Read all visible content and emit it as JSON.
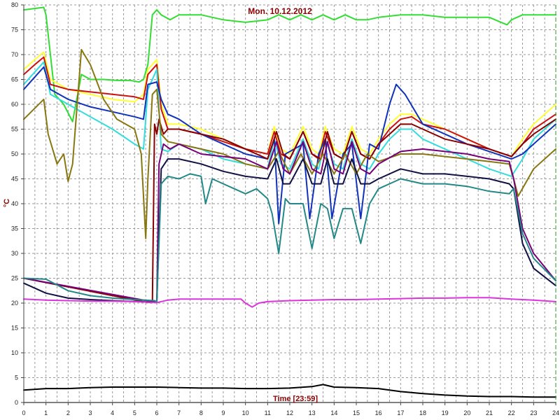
{
  "chart_data": {
    "type": "line",
    "title": "Mon. 10.12.2012",
    "xlabel": "Time [23:59]",
    "ylabel": "°C",
    "xlim": [
      0,
      24
    ],
    "ylim": [
      0,
      80
    ],
    "xticks": [
      "0",
      "1",
      "2",
      "3",
      "4",
      "5",
      "6",
      "7",
      "8",
      "9",
      "10",
      "11",
      "12",
      "13",
      "14",
      "15",
      "16",
      "17",
      "18",
      "19",
      "20",
      "21",
      "22",
      "23",
      "24"
    ],
    "yticks": [
      "0",
      "5",
      "10",
      "15",
      "20",
      "25",
      "30",
      "35",
      "40",
      "45",
      "50",
      "55",
      "60",
      "65",
      "70",
      "75",
      "80"
    ],
    "grid": true,
    "series": [
      {
        "color": "#33dd33",
        "x": [
          0,
          0.9,
          1,
          1.4,
          1.8,
          2.2,
          2.6,
          3,
          3.6,
          4.2,
          4.8,
          5.2,
          5.4,
          5.6,
          5.8,
          6,
          6.2,
          6.6,
          7,
          8,
          9,
          10,
          11,
          11.5,
          12,
          12.5,
          13,
          13.5,
          14,
          14.5,
          15,
          15.5,
          16,
          17,
          18,
          19,
          20,
          21,
          21.8,
          22,
          22.5,
          23,
          24
        ],
        "y": [
          79,
          79.5,
          78,
          62,
          60,
          56.5,
          66,
          65,
          65,
          64.8,
          64.8,
          64.5,
          65,
          68,
          78,
          79,
          78,
          77,
          78,
          78,
          77,
          76.5,
          77,
          78,
          77,
          78,
          77,
          78,
          77,
          78,
          77,
          77,
          77.5,
          78,
          78,
          77.5,
          77.5,
          77.5,
          76,
          77,
          78,
          78,
          78
        ]
      },
      {
        "color": "#ffff33",
        "x": [
          0,
          0.5,
          0.9,
          1.2,
          2,
          3,
          4,
          5,
          5.4,
          5.6,
          6,
          6.2,
          6.5,
          7,
          8,
          9,
          10,
          11,
          11.3,
          11.6,
          12,
          12.6,
          13,
          13.3,
          13.6,
          14,
          14.4,
          14.8,
          15.2,
          15.6,
          16,
          16.5,
          17,
          17.5,
          18,
          19,
          20,
          21,
          22,
          22.5,
          23,
          24
        ],
        "y": [
          67,
          69,
          70.5,
          65,
          63,
          62,
          61,
          60.5,
          62,
          67,
          69,
          60,
          56,
          56,
          55,
          53,
          51,
          50,
          55.5,
          51,
          50,
          55.5,
          51,
          50,
          55.5,
          51,
          50,
          55.5,
          51,
          50,
          53,
          56,
          58,
          58,
          57,
          55,
          53,
          51,
          49.5,
          53,
          56,
          60
        ]
      },
      {
        "color": "#cc1111",
        "x": [
          0,
          0.5,
          0.9,
          1.2,
          2,
          3,
          4,
          5,
          5.4,
          5.6,
          6,
          6.2,
          6.5,
          7,
          8,
          9,
          10,
          11,
          11.3,
          11.6,
          12,
          12.6,
          13,
          13.3,
          13.6,
          14,
          14.4,
          14.8,
          15.2,
          15.6,
          16,
          16.5,
          17,
          17.5,
          18,
          19,
          20,
          21,
          22,
          22.5,
          23,
          24
        ],
        "y": [
          66,
          68,
          69.5,
          64,
          63,
          62.5,
          62,
          61.5,
          61,
          66,
          68,
          59,
          55,
          55,
          54,
          52.5,
          51,
          50,
          54.5,
          50,
          49,
          54.5,
          50,
          49,
          54.5,
          50,
          49,
          54.5,
          50,
          49,
          52,
          55,
          57,
          57.5,
          56,
          55,
          53,
          51,
          49.5,
          52,
          55,
          58
        ]
      },
      {
        "color": "#33dddd",
        "x": [
          0,
          0.5,
          0.9,
          1.2,
          2,
          3,
          4,
          5,
          5.4,
          5.6,
          6,
          6.2,
          6.5,
          7,
          8,
          9,
          10,
          11,
          11.3,
          11.6,
          12,
          12.6,
          13,
          13.3,
          13.6,
          14,
          14.4,
          14.8,
          15.2,
          15.6,
          16,
          16.5,
          17,
          17.5,
          18,
          19,
          20,
          21,
          22,
          22.5,
          23,
          24
        ],
        "y": [
          64,
          66.5,
          68.5,
          62,
          60,
          57.5,
          55,
          52,
          51,
          63,
          67,
          51,
          50.5,
          52,
          51,
          49,
          48,
          47,
          53,
          48,
          47,
          53,
          48,
          47,
          53,
          48,
          47,
          53,
          48,
          47,
          50,
          53,
          55,
          55,
          53,
          51,
          49,
          47,
          45.5,
          49,
          53,
          57
        ]
      },
      {
        "color": "#1133bb",
        "x": [
          0,
          0.5,
          0.9,
          1.2,
          2,
          3,
          4,
          5,
          5.4,
          5.6,
          6,
          6.2,
          6.5,
          7,
          8,
          9,
          10,
          11,
          11.3,
          11.5,
          11.8,
          12.6,
          12.9,
          13.3,
          13.6,
          13.9,
          14.4,
          14.8,
          15.2,
          15.6,
          16,
          16.5,
          16.8,
          17.2,
          18,
          19,
          20,
          21,
          22,
          22.5,
          23,
          24
        ],
        "y": [
          63,
          65.5,
          67.5,
          63,
          61,
          59.5,
          58.5,
          57.5,
          57,
          64,
          64.5,
          61,
          58,
          57,
          54,
          52,
          50,
          49,
          53,
          36,
          50,
          52,
          37,
          50,
          53,
          37,
          50,
          52,
          37,
          52,
          51,
          60,
          64,
          62,
          56,
          54,
          52,
          50.5,
          49,
          50,
          52,
          56
        ]
      },
      {
        "color": "#880000",
        "x": [
          0,
          5.5,
          5.8,
          5.9,
          6,
          6.1,
          6.3,
          6.5,
          7,
          8,
          9,
          10,
          11,
          11.4,
          11.7,
          12,
          12.6,
          13,
          13.4,
          13.7,
          14,
          14.4,
          14.8,
          15.2,
          15.6,
          16,
          16.5,
          17,
          17.5,
          18,
          19,
          20,
          21,
          22,
          22.5,
          23,
          24
        ],
        "y": [
          25,
          20.2,
          20.1,
          56,
          54,
          57,
          54,
          55,
          55,
          54,
          53,
          51,
          49,
          54.5,
          50,
          49,
          54.5,
          50,
          49,
          54.5,
          50,
          49,
          54.5,
          50,
          49,
          52,
          54,
          56,
          56,
          55,
          53,
          52,
          51,
          49.5,
          52,
          54,
          57
        ]
      },
      {
        "color": "#887711",
        "x": [
          0,
          0.9,
          1.1,
          1.5,
          1.8,
          2,
          2.2,
          2.6,
          3,
          3.6,
          4.2,
          5,
          5.3,
          5.5,
          5.6,
          5.8,
          6,
          6.2,
          6.5,
          7,
          8,
          9,
          10,
          11,
          11.5,
          12,
          12.5,
          13,
          13.5,
          14,
          14.5,
          15,
          15.5,
          16,
          17,
          18,
          19,
          20,
          21,
          21.9,
          22.1,
          22.3,
          23,
          24
        ],
        "y": [
          57,
          61,
          54,
          48,
          50,
          44.5,
          48,
          71,
          68,
          61,
          57,
          55,
          50,
          33,
          45,
          62,
          63,
          54,
          52.5,
          52,
          51,
          50,
          48,
          47,
          50.5,
          46,
          50,
          46,
          50,
          46,
          50,
          46,
          50,
          48.5,
          50,
          50,
          49.5,
          49,
          48.5,
          48,
          45,
          41.5,
          47,
          51
        ]
      },
      {
        "color": "#bbbbbb",
        "x": [
          0,
          24
        ],
        "y": [
          0,
          0
        ]
      },
      {
        "color": "#770077",
        "x": [
          0,
          5.9,
          6,
          6.1,
          6.3,
          6.6,
          7,
          8,
          9,
          10,
          11,
          11.4,
          11.7,
          12,
          12.6,
          13,
          13.4,
          13.7,
          14,
          14.4,
          14.8,
          15.2,
          15.6,
          16,
          17,
          18,
          19,
          20,
          21,
          21.9,
          22.1,
          22.5,
          23,
          24
        ],
        "y": [
          25,
          20.2,
          20.1,
          48,
          52,
          51,
          52,
          50,
          49.5,
          49,
          47,
          52.5,
          47,
          46,
          52.5,
          47,
          46,
          52.5,
          47,
          46,
          52.5,
          47,
          46,
          48,
          50.5,
          51,
          50.5,
          50,
          49,
          48.5,
          45,
          35,
          30,
          24.5
        ]
      },
      {
        "color": "#111144",
        "x": [
          0,
          1,
          2,
          3,
          4,
          5,
          5.9,
          6,
          6.2,
          6.5,
          7,
          8,
          9,
          10,
          11,
          11.4,
          11.7,
          12,
          12.6,
          13,
          13.4,
          13.7,
          14,
          14.4,
          14.8,
          15.2,
          15.6,
          16,
          17,
          18,
          19,
          20,
          21,
          21.9,
          22.1,
          22.5,
          23,
          24
        ],
        "y": [
          24,
          22,
          21,
          20.7,
          20.5,
          20.3,
          20.2,
          20.1,
          47,
          49,
          49,
          48,
          46.5,
          45.5,
          45,
          49,
          44,
          44,
          49,
          44,
          44,
          49,
          44,
          44,
          49,
          44,
          44,
          45,
          47,
          46,
          46,
          45.5,
          45,
          44,
          43,
          32,
          27,
          23.5
        ]
      },
      {
        "color": "#228888",
        "x": [
          0,
          1,
          2,
          3,
          4,
          5,
          5.9,
          6,
          6.2,
          6.5,
          7,
          7.5,
          8,
          8.2,
          8.5,
          9,
          9.5,
          10,
          10.5,
          11,
          11.2,
          11.5,
          11.8,
          12,
          12.6,
          13,
          13.4,
          13.7,
          14,
          14.4,
          14.8,
          15.2,
          15.6,
          16,
          17,
          18,
          19,
          20,
          21,
          21.9,
          22.1,
          22.5,
          23,
          24
        ],
        "y": [
          25,
          24.8,
          22.5,
          21.5,
          21,
          20.7,
          20.5,
          20.3,
          44,
          45.5,
          45,
          46,
          45.5,
          40,
          45,
          44,
          43,
          42,
          43,
          41,
          38,
          30,
          41,
          40,
          40,
          31,
          40,
          39,
          33,
          39,
          39,
          32,
          40,
          43,
          45,
          44,
          44,
          43.5,
          42.5,
          42,
          43,
          34,
          29,
          24.5
        ]
      },
      {
        "color": "#dd33dd",
        "x": [
          0,
          1,
          2,
          3,
          4,
          5,
          6,
          6.5,
          7,
          8,
          9,
          9.8,
          10,
          10.3,
          10.6,
          11,
          12,
          13,
          14,
          15,
          16,
          17,
          18,
          19,
          20,
          21,
          22,
          23,
          24
        ],
        "y": [
          20.8,
          20.6,
          20.5,
          20.4,
          20.4,
          20.3,
          20.1,
          20.6,
          20.8,
          20.8,
          20.8,
          20.8,
          20,
          19.2,
          20,
          20.3,
          20.5,
          20.6,
          20.7,
          20.7,
          20.8,
          20.9,
          21,
          21,
          21.1,
          21.1,
          20.8,
          20.6,
          20.3
        ]
      },
      {
        "color": "#000000",
        "x": [
          0,
          1,
          2,
          3,
          4,
          5,
          6,
          7,
          8,
          9,
          10,
          11,
          12,
          13,
          13.5,
          14,
          15,
          16,
          17,
          18,
          19,
          20,
          21,
          22,
          23,
          24
        ],
        "y": [
          2.5,
          2.8,
          2.8,
          3,
          3.1,
          3.1,
          3.1,
          3,
          2.9,
          2.9,
          2.8,
          2.8,
          2.9,
          3.2,
          3.6,
          3.1,
          3,
          2.8,
          2.2,
          1.8,
          1.5,
          1.3,
          1.2,
          1.2,
          1.1,
          1.1
        ]
      }
    ]
  }
}
